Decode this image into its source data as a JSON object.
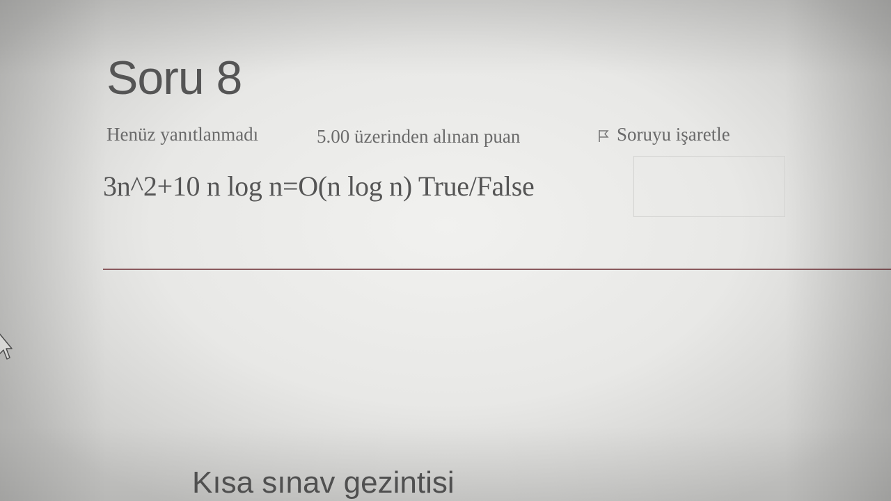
{
  "question": {
    "title": "Soru 8",
    "status": "Henüz yanıtlanmadı",
    "points": "5.00 üzerinden alınan puan",
    "flag_label": "Soruyu işaretle",
    "flag_icon": "flag-icon",
    "text": "3n^2+10 n log n=O(n log n) True/False",
    "answer_value": ""
  },
  "navigation": {
    "heading": "Kısa sınav gezintisi"
  },
  "colors": {
    "separator": "#8a5a5e",
    "text": "#555555"
  }
}
